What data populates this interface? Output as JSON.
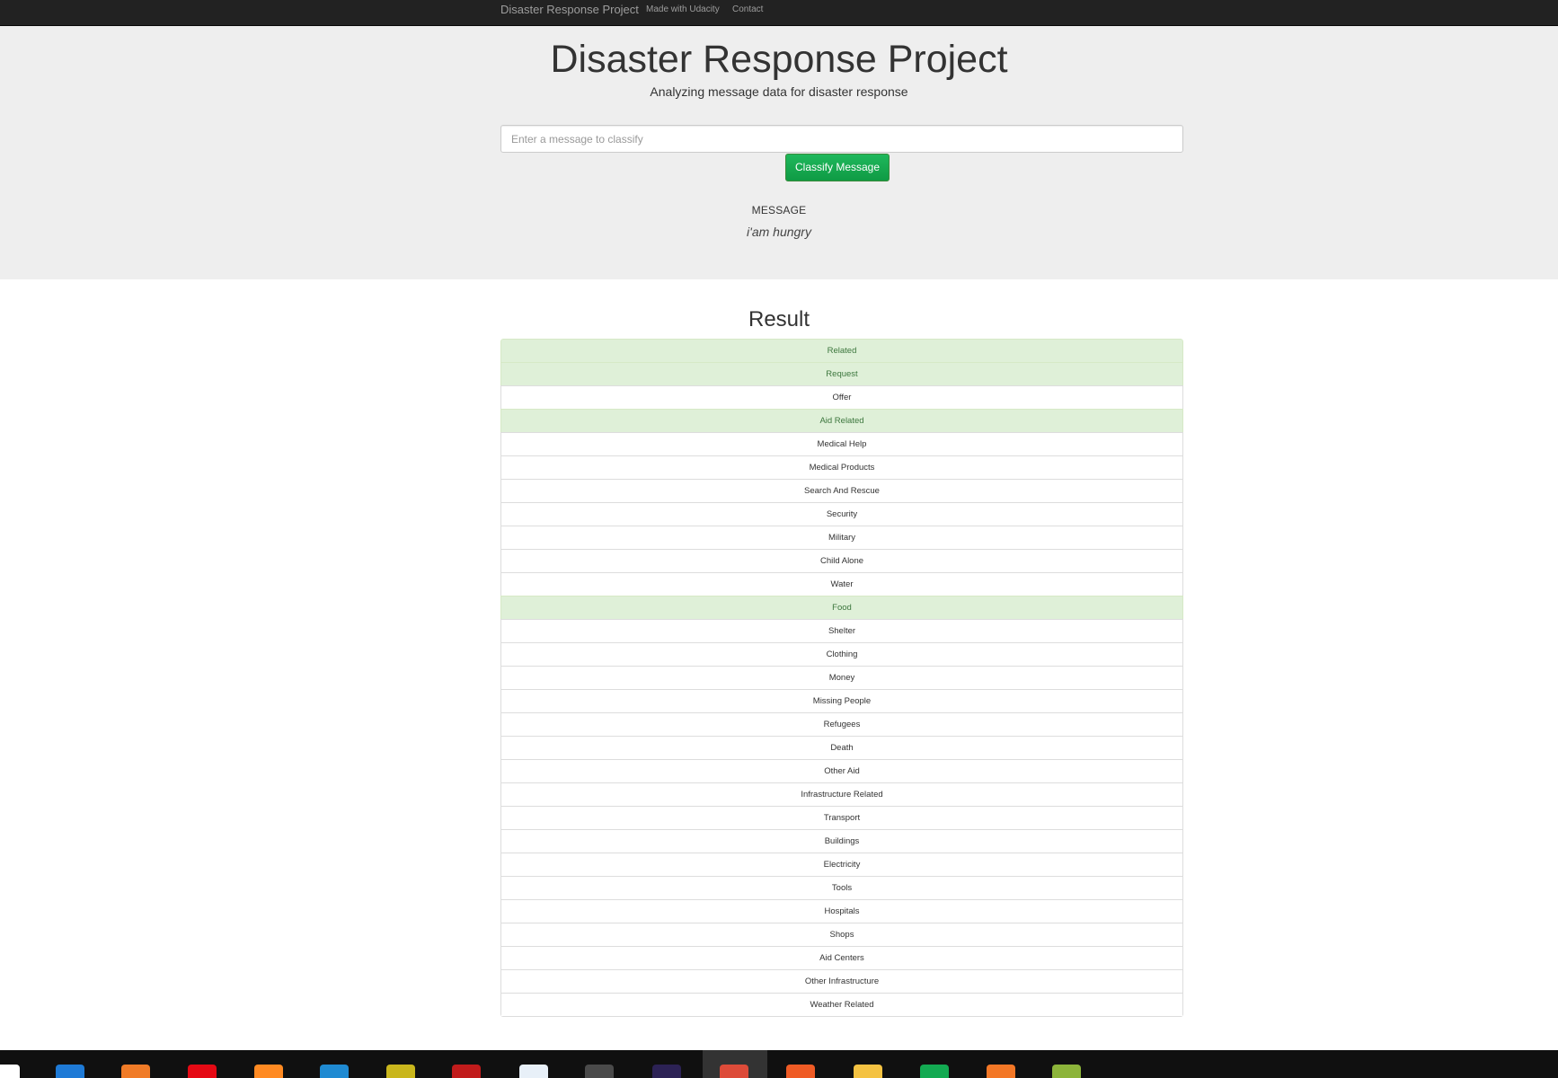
{
  "navbar": {
    "brand": "Disaster Response Project",
    "links": [
      "Made with Udacity",
      "Contact"
    ]
  },
  "header": {
    "title": "Disaster Response Project",
    "subtitle": "Analyzing message data for disaster response"
  },
  "form": {
    "placeholder": "Enter a message to classify",
    "button_label": "Classify Message"
  },
  "message": {
    "label": "MESSAGE",
    "text": "i'am hungry"
  },
  "result": {
    "title": "Result",
    "categories": [
      {
        "label": "Related",
        "positive": true
      },
      {
        "label": "Request",
        "positive": true
      },
      {
        "label": "Offer",
        "positive": false
      },
      {
        "label": "Aid Related",
        "positive": true
      },
      {
        "label": "Medical Help",
        "positive": false
      },
      {
        "label": "Medical Products",
        "positive": false
      },
      {
        "label": "Search And Rescue",
        "positive": false
      },
      {
        "label": "Security",
        "positive": false
      },
      {
        "label": "Military",
        "positive": false
      },
      {
        "label": "Child Alone",
        "positive": false
      },
      {
        "label": "Water",
        "positive": false
      },
      {
        "label": "Food",
        "positive": true
      },
      {
        "label": "Shelter",
        "positive": false
      },
      {
        "label": "Clothing",
        "positive": false
      },
      {
        "label": "Money",
        "positive": false
      },
      {
        "label": "Missing People",
        "positive": false
      },
      {
        "label": "Refugees",
        "positive": false
      },
      {
        "label": "Death",
        "positive": false
      },
      {
        "label": "Other Aid",
        "positive": false
      },
      {
        "label": "Infrastructure Related",
        "positive": false
      },
      {
        "label": "Transport",
        "positive": false
      },
      {
        "label": "Buildings",
        "positive": false
      },
      {
        "label": "Electricity",
        "positive": false
      },
      {
        "label": "Tools",
        "positive": false
      },
      {
        "label": "Hospitals",
        "positive": false
      },
      {
        "label": "Shops",
        "positive": false
      },
      {
        "label": "Aid Centers",
        "positive": false
      },
      {
        "label": "Other Infrastructure",
        "positive": false
      },
      {
        "label": "Weather Related",
        "positive": false
      }
    ]
  },
  "colors": {
    "navbar": "#222222",
    "jumbotron": "#eeeeee",
    "button": "#15a84f",
    "positive_bg": "#dff0d8",
    "positive_text": "#3c763d"
  },
  "taskbar": {
    "icons": [
      {
        "name": "store-icon",
        "color": "#ffffff"
      },
      {
        "name": "mail-icon",
        "color": "#1e7ad6"
      },
      {
        "name": "xampp-icon",
        "color": "#f07b27"
      },
      {
        "name": "netflix-icon",
        "color": "#e50914"
      },
      {
        "name": "firefox-icon",
        "color": "#ff8a22"
      },
      {
        "name": "vscode-icon",
        "color": "#1f8ad2"
      },
      {
        "name": "anaconda-icon",
        "color": "#c9b61c"
      },
      {
        "name": "filezilla-icon",
        "color": "#c11b1b"
      },
      {
        "name": "tableau-icon",
        "color": "#e8f0f8"
      },
      {
        "name": "sublime-icon",
        "color": "#4a4a4a"
      },
      {
        "name": "eclipse-icon",
        "color": "#2c2255"
      },
      {
        "name": "chrome-icon",
        "color": "#dd4b39"
      },
      {
        "name": "postman-icon",
        "color": "#ef5b25"
      },
      {
        "name": "folder-icon",
        "color": "#f4c242"
      },
      {
        "name": "mongodb-icon",
        "color": "#13aa52"
      },
      {
        "name": "jupyter-icon",
        "color": "#f37726"
      },
      {
        "name": "matlab-icon",
        "color": "#8cb43a"
      }
    ]
  }
}
